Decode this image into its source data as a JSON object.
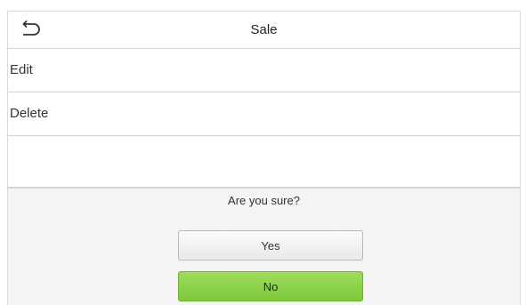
{
  "header": {
    "title": "Sale",
    "back_icon": "back-arrow-icon"
  },
  "menu": {
    "items": [
      {
        "label": "Edit"
      },
      {
        "label": "Delete"
      },
      {
        "label": ""
      }
    ]
  },
  "dialog": {
    "prompt": "Are you sure?",
    "yes_label": "Yes",
    "no_label": "No"
  },
  "colors": {
    "accent_green": "#8ed14b",
    "background": "#f4f4f4"
  }
}
